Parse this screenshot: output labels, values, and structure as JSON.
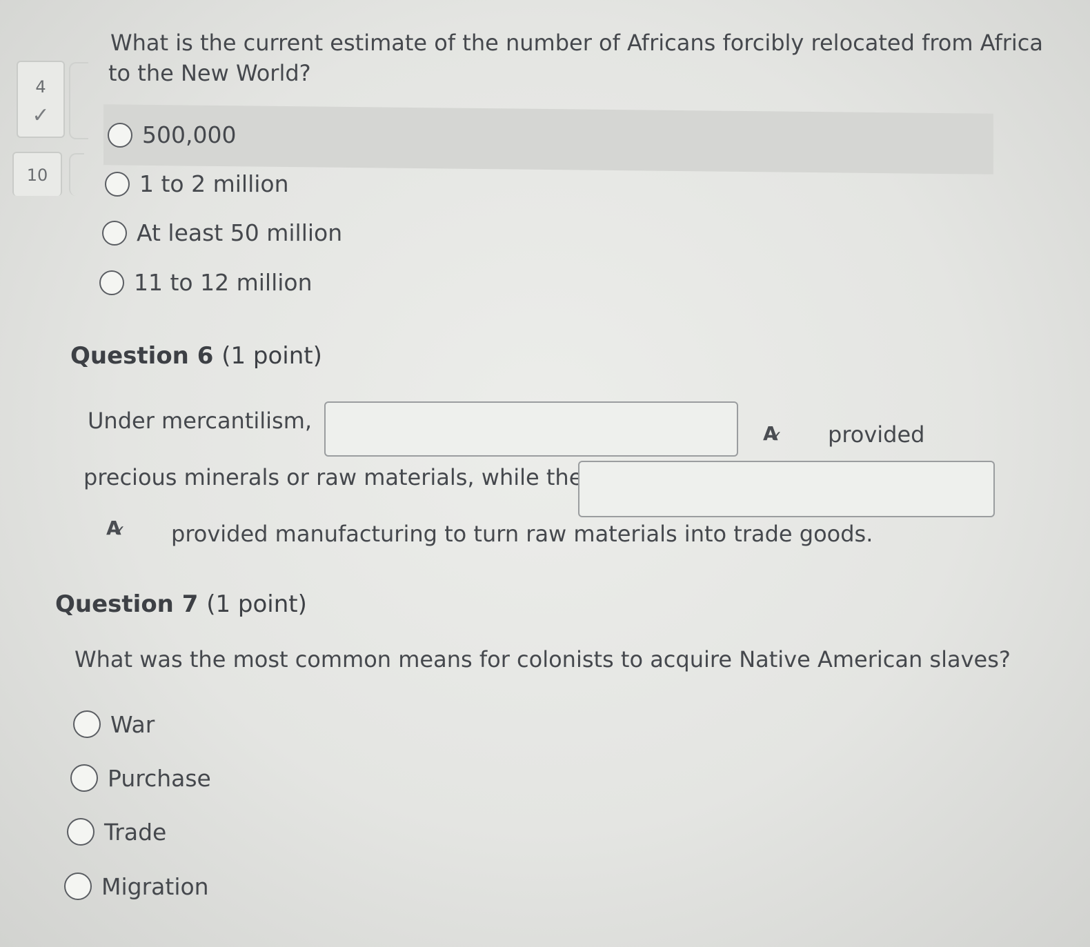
{
  "navigator": {
    "tiles": [
      {
        "number": "4",
        "status": "✓"
      },
      {
        "number": "10"
      }
    ]
  },
  "question5": {
    "text_line1": "What is the current estimate of the number of Africans forcibly relocated from Africa",
    "text_line2": "to the New World?",
    "options": [
      "500,000",
      "1 to 2 million",
      "At least 50 million",
      "11 to 12 million"
    ]
  },
  "question6": {
    "title": "Question 6",
    "points": "(1 point)",
    "part1": "Under mercantilism,",
    "part2": "provided",
    "part3": "precious minerals or raw materials, while the",
    "part4": "provided manufacturing to turn raw materials into trade goods.",
    "blank1_value": "",
    "blank2_value": "",
    "spellcheck_icon": "spellcheck-icon"
  },
  "question7": {
    "title": "Question 7",
    "points": "(1 point)",
    "text": "What was the most common means for colonists to acquire Native American slaves?",
    "options": [
      "War",
      "Purchase",
      "Trade",
      "Migration"
    ]
  },
  "colors": {
    "background": "#e6e7e4",
    "highlight_row": "#d5d6d3",
    "text": "#45484d"
  }
}
